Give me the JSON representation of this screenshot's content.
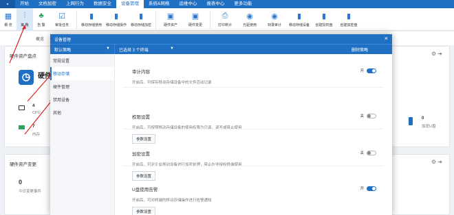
{
  "app_button": "▪",
  "menu": [
    "开始",
    "文档加密",
    "上网行为",
    "数据安全",
    "设备管理",
    "系统&网络",
    "运维中心",
    "报表中心",
    "更多功能"
  ],
  "menu_active_index": 4,
  "ribbon": [
    {
      "label": "概 览",
      "icon": "grid-icon"
    },
    {
      "label": "策 略",
      "icon": "sliders-icon"
    },
    {
      "label": "告 警",
      "icon": "bell-icon"
    },
    {
      "label": "审批任务",
      "icon": "checklist-icon"
    },
    {
      "label": "移动存储使用",
      "icon": "usb-icon"
    },
    {
      "label": "移动存储操作",
      "icon": "usb-icon"
    },
    {
      "label": "移动存储加密",
      "icon": "usb-lock-icon"
    },
    {
      "label": "硬件资产",
      "icon": "chip-icon"
    },
    {
      "label": "硬件变更",
      "icon": "chip-icon"
    },
    {
      "label": "打印统计",
      "icon": "printer-icon"
    },
    {
      "label": "光驱使用",
      "icon": "disc-icon"
    },
    {
      "label": "刻录审计",
      "icon": "disc-icon"
    },
    {
      "label": "移动存储设备",
      "icon": "usb-icon"
    },
    {
      "label": "创建授权盘",
      "icon": "usb-icon"
    },
    {
      "label": "创建加密盘",
      "icon": "usb-icon"
    }
  ],
  "breadcrumb": "概览",
  "bg": {
    "card1_title": "硬件资产盘点",
    "hw_label": "硬件资",
    "cpu_value": "4",
    "cpu_label": "CPU",
    "mem_value": "7",
    "mem_label": "内存",
    "usb_value": "0",
    "usb_label": "加密U盘",
    "card2_title": "硬件资产变更",
    "change_value": "0",
    "change_label": "今日变更事件"
  },
  "dialog": {
    "title": "设备管理",
    "policy_select": "默认策略",
    "selected_count": "已选择 3 个终端",
    "delete_policy": "删除策略",
    "sidebar": [
      "常规设置",
      "移动存储",
      "硬件管理",
      "禁用设备",
      "其他"
    ],
    "sidebar_active_index": 1,
    "sections": [
      {
        "title": "审计内容",
        "desc": "开启后，可保存移动存储设备中的文件活动记录",
        "toggle_label": "开",
        "on": true,
        "button": ""
      },
      {
        "title": "权限设置",
        "desc": "开启后，可按照移动存储设备的使用权限为只读、读写或禁止使用",
        "toggle_label": "关",
        "on": false,
        "button": "参数设置"
      },
      {
        "title": "加密设置",
        "desc": "开启后，可对企业移动设备进行加密处理，禁止在非授权终端使用",
        "toggle_label": "关",
        "on": false,
        "button": "参数设置"
      },
      {
        "title": "U盘使用告警",
        "desc": "开启后，可对终端的移动存储操作进行告警通知",
        "toggle_label": "开",
        "on": true,
        "button": "参数设置"
      }
    ]
  }
}
